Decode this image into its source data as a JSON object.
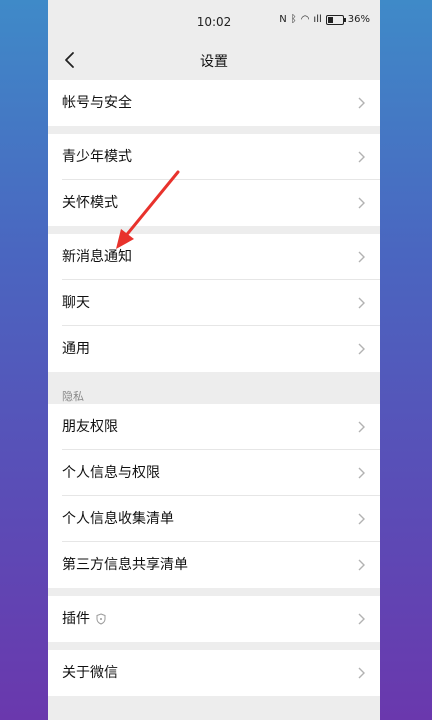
{
  "status_bar": {
    "time": "10:02",
    "nfc": "N",
    "bluetooth": "ᛒ",
    "wifi": "◠",
    "signal": "ıll",
    "battery": "36%",
    "battery_fraction": 0.36
  },
  "nav": {
    "title": "设置",
    "back_icon": "chevron-left-icon"
  },
  "groups": [
    {
      "items": [
        {
          "label": "帐号与安全"
        }
      ]
    },
    {
      "items": [
        {
          "label": "青少年模式"
        },
        {
          "label": "关怀模式"
        }
      ]
    },
    {
      "items": [
        {
          "label": "新消息通知"
        },
        {
          "label": "聊天"
        },
        {
          "label": "通用"
        }
      ]
    }
  ],
  "privacy": {
    "header": "隐私",
    "items": [
      {
        "label": "朋友权限"
      },
      {
        "label": "个人信息与权限"
      },
      {
        "label": "个人信息收集清单"
      },
      {
        "label": "第三方信息共享清单"
      }
    ]
  },
  "plugins": {
    "label": "插件",
    "icon": "shield-icon"
  },
  "about": {
    "label": "关于微信"
  },
  "colors": {
    "background": "#ededed",
    "cell": "#ffffff",
    "annotation_arrow": "#e8322c"
  }
}
